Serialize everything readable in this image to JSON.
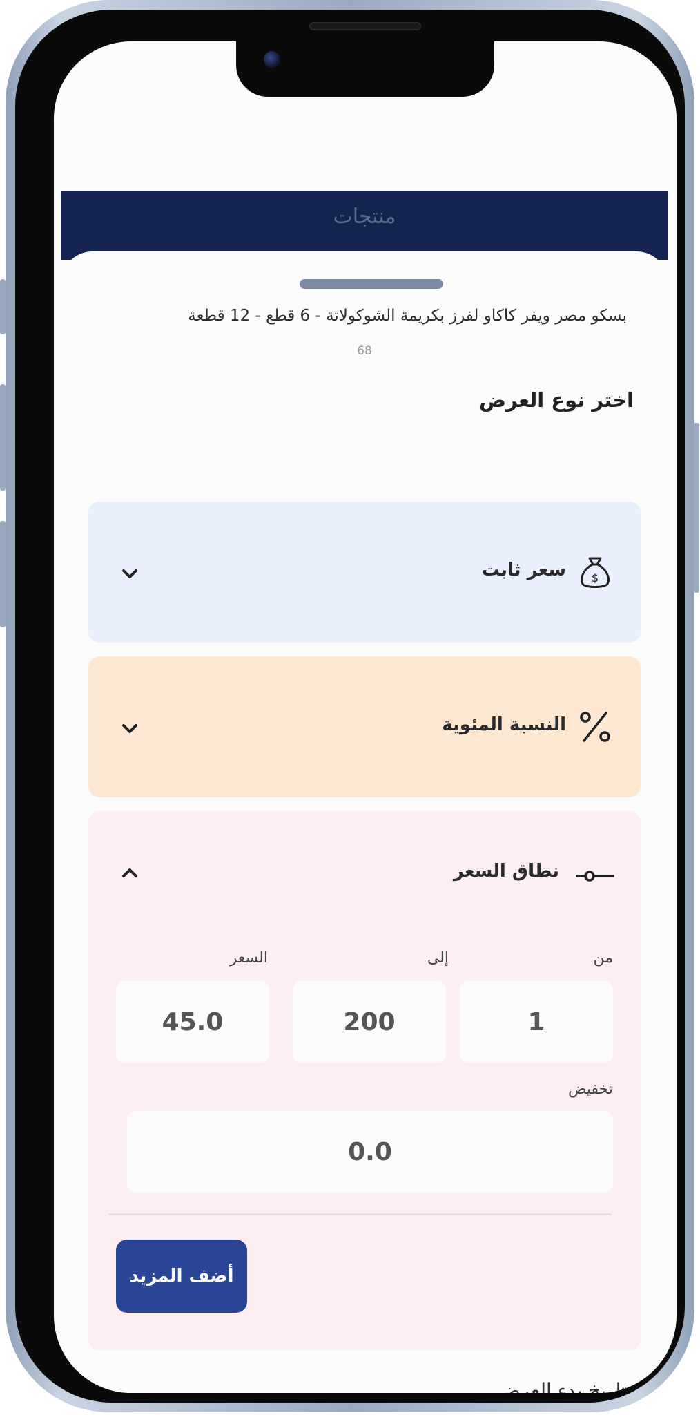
{
  "header": {
    "title": "منتجات"
  },
  "product": {
    "name": "بسكو مصر ويفر كاكاو لفرز بكريمة الشوكولاتة - 6 قطع - 12 قطعة",
    "sub_value": "68"
  },
  "offer_type": {
    "section_title": "اختر نوع العرض",
    "options": [
      {
        "label": "سعر ثابت",
        "icon": "money-bag-icon",
        "expanded": false
      },
      {
        "label": "النسبة المئوية",
        "icon": "percent-icon",
        "expanded": false
      },
      {
        "label": "نطاق السعر",
        "icon": "range-slider-icon",
        "expanded": true
      }
    ]
  },
  "price_range": {
    "from_label": "من",
    "to_label": "إلى",
    "price_label": "السعر",
    "from_value": "1",
    "to_value": "200",
    "price_value": "45.0",
    "discount_label": "تخفيض",
    "discount_value": "0.0",
    "add_more_label": "أضف المزيد"
  },
  "start_date": {
    "label": "تاريخ بدء العرض"
  },
  "colors": {
    "header_bg": "#14234f",
    "fixed_card_bg": "#e9effc",
    "percent_card_bg": "#fde7d1",
    "range_card_bg": "#fdeff1",
    "button_bg": "#2a4596"
  }
}
